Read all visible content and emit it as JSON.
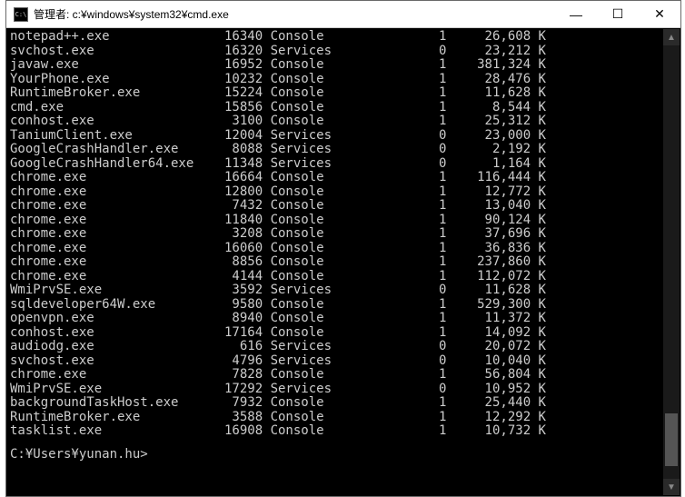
{
  "window": {
    "title": "管理者: c:¥windows¥system32¥cmd.exe",
    "icon_label": "C:\\"
  },
  "controls": {
    "minimize": "—",
    "maximize": "☐",
    "close": "✕"
  },
  "processes": [
    {
      "name": "notepad++.exe",
      "pid": "16340",
      "sess_name": "Console",
      "sess": "1",
      "mem": "26,608 K"
    },
    {
      "name": "svchost.exe",
      "pid": "16320",
      "sess_name": "Services",
      "sess": "0",
      "mem": "23,212 K"
    },
    {
      "name": "javaw.exe",
      "pid": "16952",
      "sess_name": "Console",
      "sess": "1",
      "mem": "381,324 K"
    },
    {
      "name": "YourPhone.exe",
      "pid": "10232",
      "sess_name": "Console",
      "sess": "1",
      "mem": "28,476 K"
    },
    {
      "name": "RuntimeBroker.exe",
      "pid": "15224",
      "sess_name": "Console",
      "sess": "1",
      "mem": "11,628 K"
    },
    {
      "name": "cmd.exe",
      "pid": "15856",
      "sess_name": "Console",
      "sess": "1",
      "mem": "8,544 K"
    },
    {
      "name": "conhost.exe",
      "pid": "3100",
      "sess_name": "Console",
      "sess": "1",
      "mem": "25,312 K"
    },
    {
      "name": "TaniumClient.exe",
      "pid": "12004",
      "sess_name": "Services",
      "sess": "0",
      "mem": "23,000 K"
    },
    {
      "name": "GoogleCrashHandler.exe",
      "pid": "8088",
      "sess_name": "Services",
      "sess": "0",
      "mem": "2,192 K"
    },
    {
      "name": "GoogleCrashHandler64.exe",
      "pid": "11348",
      "sess_name": "Services",
      "sess": "0",
      "mem": "1,164 K"
    },
    {
      "name": "chrome.exe",
      "pid": "16664",
      "sess_name": "Console",
      "sess": "1",
      "mem": "116,444 K"
    },
    {
      "name": "chrome.exe",
      "pid": "12800",
      "sess_name": "Console",
      "sess": "1",
      "mem": "12,772 K"
    },
    {
      "name": "chrome.exe",
      "pid": "7432",
      "sess_name": "Console",
      "sess": "1",
      "mem": "13,040 K"
    },
    {
      "name": "chrome.exe",
      "pid": "11840",
      "sess_name": "Console",
      "sess": "1",
      "mem": "90,124 K"
    },
    {
      "name": "chrome.exe",
      "pid": "3208",
      "sess_name": "Console",
      "sess": "1",
      "mem": "37,696 K"
    },
    {
      "name": "chrome.exe",
      "pid": "16060",
      "sess_name": "Console",
      "sess": "1",
      "mem": "36,836 K"
    },
    {
      "name": "chrome.exe",
      "pid": "8856",
      "sess_name": "Console",
      "sess": "1",
      "mem": "237,860 K"
    },
    {
      "name": "chrome.exe",
      "pid": "4144",
      "sess_name": "Console",
      "sess": "1",
      "mem": "112,072 K"
    },
    {
      "name": "WmiPrvSE.exe",
      "pid": "3592",
      "sess_name": "Services",
      "sess": "0",
      "mem": "11,628 K"
    },
    {
      "name": "sqldeveloper64W.exe",
      "pid": "9580",
      "sess_name": "Console",
      "sess": "1",
      "mem": "529,300 K"
    },
    {
      "name": "openvpn.exe",
      "pid": "8940",
      "sess_name": "Console",
      "sess": "1",
      "mem": "11,372 K"
    },
    {
      "name": "conhost.exe",
      "pid": "17164",
      "sess_name": "Console",
      "sess": "1",
      "mem": "14,092 K"
    },
    {
      "name": "audiodg.exe",
      "pid": "616",
      "sess_name": "Services",
      "sess": "0",
      "mem": "20,072 K"
    },
    {
      "name": "svchost.exe",
      "pid": "4796",
      "sess_name": "Services",
      "sess": "0",
      "mem": "10,040 K"
    },
    {
      "name": "chrome.exe",
      "pid": "7828",
      "sess_name": "Console",
      "sess": "1",
      "mem": "56,804 K"
    },
    {
      "name": "WmiPrvSE.exe",
      "pid": "17292",
      "sess_name": "Services",
      "sess": "0",
      "mem": "10,952 K"
    },
    {
      "name": "backgroundTaskHost.exe",
      "pid": "7932",
      "sess_name": "Console",
      "sess": "1",
      "mem": "25,440 K"
    },
    {
      "name": "RuntimeBroker.exe",
      "pid": "3588",
      "sess_name": "Console",
      "sess": "1",
      "mem": "12,292 K"
    },
    {
      "name": "tasklist.exe",
      "pid": "16908",
      "sess_name": "Console",
      "sess": "1",
      "mem": "10,732 K"
    }
  ],
  "prompt": "C:¥Users¥yunan.hu>"
}
